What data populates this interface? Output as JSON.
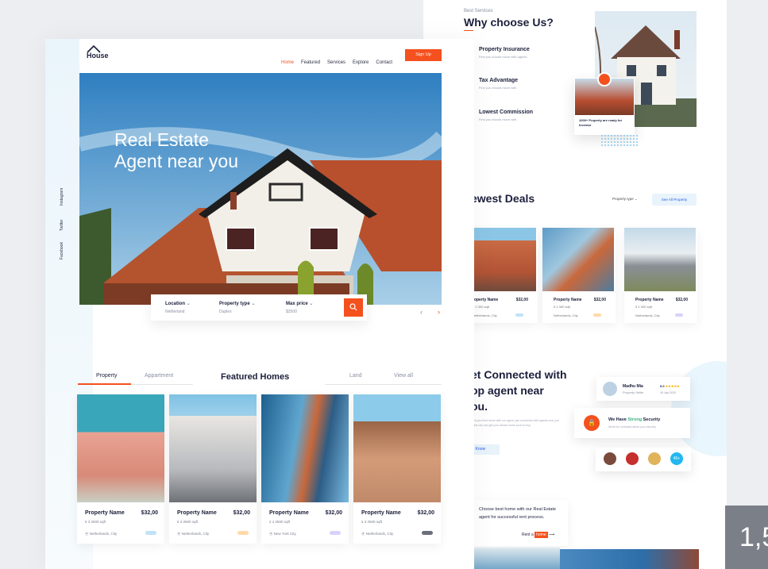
{
  "right_page": {
    "why": {
      "tag": "Best Services",
      "title": "Why choose Us?",
      "items": [
        {
          "title": "Property Insurance",
          "sub": "Find you should move with agents"
        },
        {
          "title": "Tax Advantage",
          "sub": "Find you should move with"
        },
        {
          "title": "Lowest Commission",
          "sub": "Find you should move with"
        }
      ],
      "badge_text": "1000+ Property are ready for Investor"
    },
    "deals": {
      "title": "ewest Deals",
      "filter_label": "Property type",
      "see_all_label": "See All Property",
      "cards": [
        {
          "name": "roperty Name",
          "price": "$32,00",
          "meta": "5  2  300 sqft",
          "loc": "Netherlands, City",
          "badge_color": "#bfe3f7"
        },
        {
          "name": "Property Name",
          "price": "$32,00",
          "meta": "5  2  300 sqft",
          "loc": "Netherlands, City",
          "badge_color": "#ffd9a8"
        },
        {
          "name": "Property Name",
          "price": "$32,00",
          "meta": "5  2  300 sqft",
          "loc": "Netherlands, City",
          "badge_color": "#d7d3fb"
        }
      ]
    },
    "connected": {
      "title_lines": [
        "et Connected with",
        "op agent near",
        "ou."
      ],
      "body": "Find you best home with our agent, get connected with agents near you in the city and get your dream home soon to buy.",
      "button_label": "et Know",
      "agent_name": "Madhu Mia",
      "agent_role": "Property Seller",
      "rating": "5.0",
      "rating_date": "15 July 2020",
      "security_title_pre": "We Have ",
      "security_title_hl": "Strong",
      "security_title_post": " Security",
      "security_sub": "Never be confused about your security",
      "more_count": "45+"
    },
    "bottom": {
      "text": "Choose best home with our Real Estate agent for successful rent process.",
      "rent_pre": "Rent a ",
      "rent_hl": "home"
    }
  },
  "left_page": {
    "logo": "House",
    "nav": [
      "Home",
      "Featured",
      "Services",
      "Explore",
      "Contact"
    ],
    "signup_label": "Sign Up",
    "hero_title_lines": [
      "Real Estate",
      "Agent near you"
    ],
    "social": [
      "Instagram",
      "Twitter",
      "Facebook"
    ],
    "search": {
      "location_label": "Location",
      "location_value": "Netherland",
      "type_label": "Property type",
      "type_value": "Duplex",
      "price_label": "Max price",
      "price_value": "$2500"
    },
    "tabs": [
      "Property",
      "Appartment",
      "Land",
      "View all"
    ],
    "featured_title": "Featured Homes",
    "cards": [
      {
        "name": "Property Name",
        "price": "$32,00",
        "meta": "5    3    2500 sqft",
        "loc": "Netherlands, City",
        "badge_color": "#bfe3f7"
      },
      {
        "name": "Property Name",
        "price": "$32,00",
        "meta": "5    3    2500 sqft",
        "loc": "Netherlands, City",
        "badge_color": "#ffd9a8"
      },
      {
        "name": "Property Name",
        "price": "$32,00",
        "meta": "2    4    2500 sqft",
        "loc": "New York City",
        "badge_color": "#d7d3fb"
      },
      {
        "name": "Property Name",
        "price": "$32,00",
        "meta": "5    3    2500 sqft",
        "loc": "Netherlands, City",
        "badge_color": "#6b6f7d"
      }
    ]
  },
  "counter": "1,5",
  "accent": "#f4511e",
  "navy": "#1b1f3b"
}
